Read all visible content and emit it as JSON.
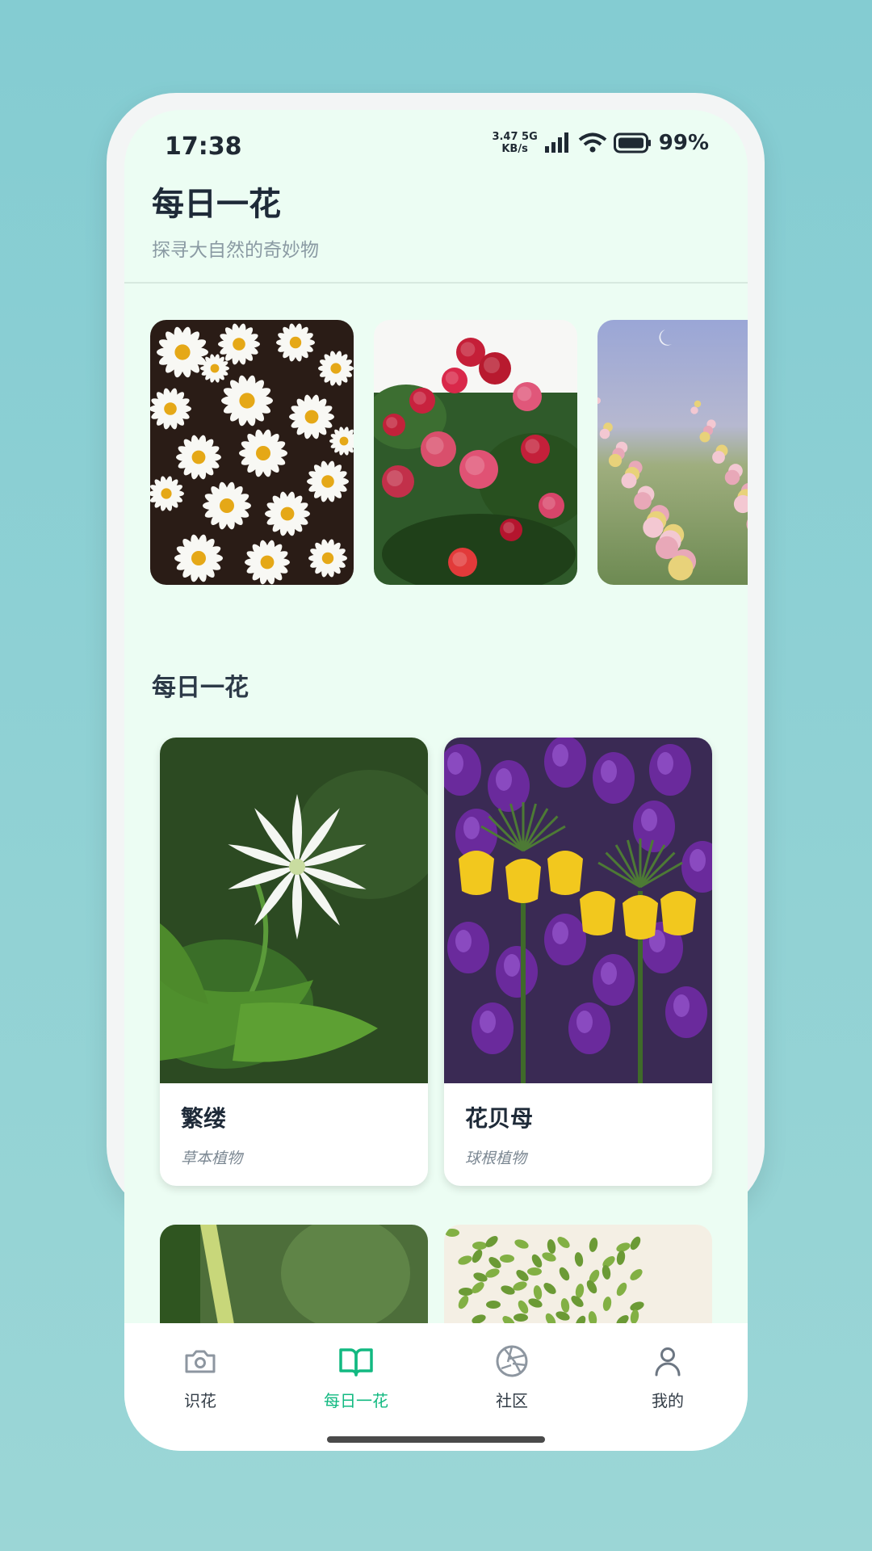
{
  "status_bar": {
    "time": "17:38",
    "net_speed_value": "3.47",
    "net_speed_unit": "KB/s",
    "network_type": "5G",
    "battery": "99%"
  },
  "header": {
    "title": "每日一花",
    "subtitle": "探寻大自然的奇妙物"
  },
  "carousel": {
    "items": [
      {
        "image": "white-daisies-photo"
      },
      {
        "image": "red-roses-photo"
      },
      {
        "image": "pink-rose-field-photo"
      }
    ]
  },
  "section": {
    "title": "每日一花",
    "cards": [
      {
        "name": "繁缕",
        "type": "草本植物",
        "image": "white-star-flower-photo"
      },
      {
        "name": "花贝母",
        "type": "球根植物",
        "image": "crown-imperial-fritillary-photo"
      }
    ],
    "partial_cards": [
      {
        "image": "green-stem-photo"
      },
      {
        "image": "potted-shrub-photo"
      }
    ]
  },
  "bottom_nav": {
    "active_index": 1,
    "accent_color": "#12b981",
    "items": [
      {
        "label": "识花",
        "icon": "camera-icon"
      },
      {
        "label": "每日一花",
        "icon": "open-book-icon"
      },
      {
        "label": "社区",
        "icon": "aperture-icon"
      },
      {
        "label": "我的",
        "icon": "user-icon"
      }
    ]
  }
}
